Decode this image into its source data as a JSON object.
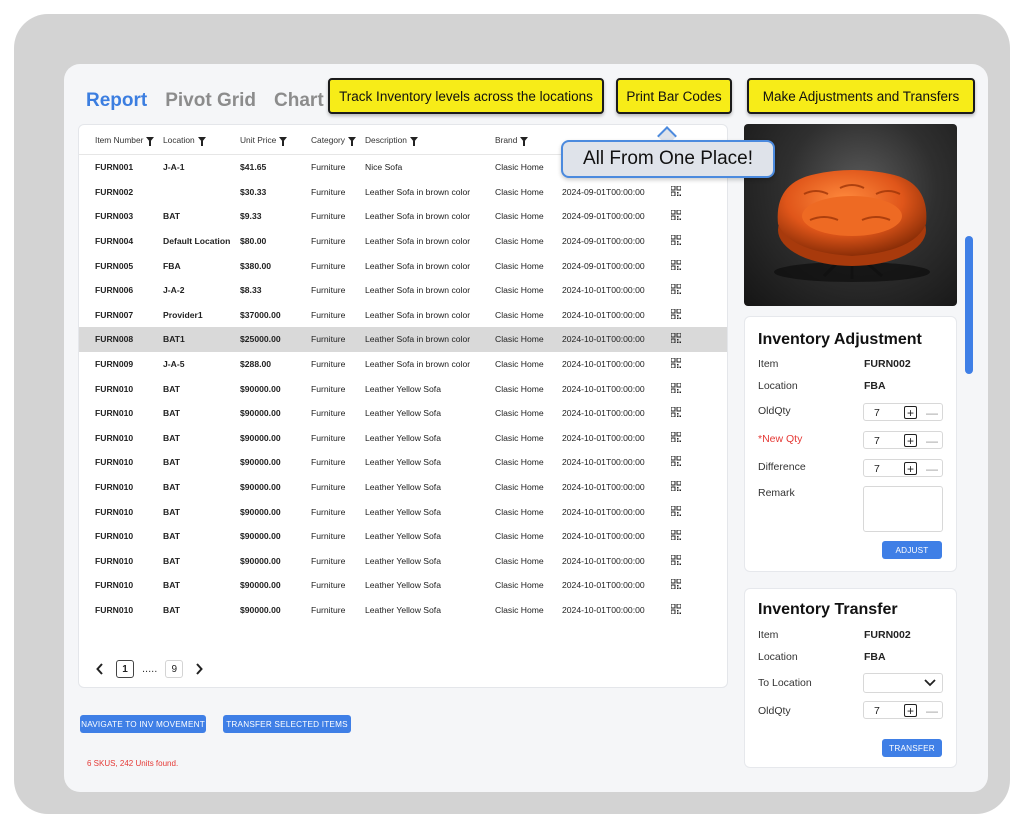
{
  "tabs": [
    {
      "label": "Report",
      "active": true
    },
    {
      "label": "Pivot Grid",
      "active": false
    },
    {
      "label": "Chart",
      "active": false
    }
  ],
  "callouts": {
    "track": "Track Inventory levels across the locations",
    "print": "Print Bar Codes",
    "adjust": "Make Adjustments and Transfers",
    "bubble": "All From One Place!"
  },
  "table": {
    "columns": [
      "Item Number",
      "Location",
      "Unit Price",
      "Category",
      "Description",
      "Brand"
    ],
    "rows": [
      {
        "item": "FURN001",
        "location": "J-A-1",
        "price": "$41.65",
        "category": "Furniture",
        "description": "Nice Sofa",
        "brand": "Clasic Home",
        "date": ""
      },
      {
        "item": "FURN002",
        "location": "",
        "price": "$30.33",
        "category": "Furniture",
        "description": "Leather Sofa in brown color",
        "brand": "Clasic Home",
        "date": "2024-09-01T00:00:00"
      },
      {
        "item": "FURN003",
        "location": "BAT",
        "price": "$9.33",
        "category": "Furniture",
        "description": "Leather Sofa in brown color",
        "brand": "Clasic Home",
        "date": "2024-09-01T00:00:00"
      },
      {
        "item": "FURN004",
        "location": "Default Location",
        "price": "$80.00",
        "category": "Furniture",
        "description": "Leather Sofa in brown color",
        "brand": "Clasic Home",
        "date": "2024-09-01T00:00:00"
      },
      {
        "item": "FURN005",
        "location": "FBA",
        "price": "$380.00",
        "category": "Furniture",
        "description": "Leather Sofa in brown color",
        "brand": "Clasic Home",
        "date": "2024-09-01T00:00:00"
      },
      {
        "item": "FURN006",
        "location": "J-A-2",
        "price": "$8.33",
        "category": "Furniture",
        "description": "Leather Sofa in brown color",
        "brand": "Clasic Home",
        "date": "2024-10-01T00:00:00"
      },
      {
        "item": "FURN007",
        "location": "Provider1",
        "price": "$37000.00",
        "category": "Furniture",
        "description": "Leather Sofa in brown color",
        "brand": "Clasic Home",
        "date": "2024-10-01T00:00:00"
      },
      {
        "item": "FURN008",
        "location": "BAT1",
        "price": "$25000.00",
        "category": "Furniture",
        "description": "Leather Sofa in brown color",
        "brand": "Clasic Home",
        "date": "2024-10-01T00:00:00",
        "selected": true
      },
      {
        "item": "FURN009",
        "location": "J-A-5",
        "price": "$288.00",
        "category": "Furniture",
        "description": "Leather Sofa in brown color",
        "brand": "Clasic Home",
        "date": "2024-10-01T00:00:00"
      },
      {
        "item": "FURN010",
        "location": "BAT",
        "price": "$90000.00",
        "category": "Furniture",
        "description": "Leather Yellow Sofa",
        "brand": "Clasic Home",
        "date": "2024-10-01T00:00:00"
      },
      {
        "item": "FURN010",
        "location": "BAT",
        "price": "$90000.00",
        "category": "Furniture",
        "description": "Leather Yellow Sofa",
        "brand": "Clasic Home",
        "date": "2024-10-01T00:00:00"
      },
      {
        "item": "FURN010",
        "location": "BAT",
        "price": "$90000.00",
        "category": "Furniture",
        "description": "Leather Yellow Sofa",
        "brand": "Clasic Home",
        "date": "2024-10-01T00:00:00"
      },
      {
        "item": "FURN010",
        "location": "BAT",
        "price": "$90000.00",
        "category": "Furniture",
        "description": "Leather Yellow Sofa",
        "brand": "Clasic Home",
        "date": "2024-10-01T00:00:00"
      },
      {
        "item": "FURN010",
        "location": "BAT",
        "price": "$90000.00",
        "category": "Furniture",
        "description": "Leather Yellow Sofa",
        "brand": "Clasic Home",
        "date": "2024-10-01T00:00:00"
      },
      {
        "item": "FURN010",
        "location": "BAT",
        "price": "$90000.00",
        "category": "Furniture",
        "description": "Leather Yellow Sofa",
        "brand": "Clasic Home",
        "date": "2024-10-01T00:00:00"
      },
      {
        "item": "FURN010",
        "location": "BAT",
        "price": "$90000.00",
        "category": "Furniture",
        "description": "Leather Yellow Sofa",
        "brand": "Clasic Home",
        "date": "2024-10-01T00:00:00"
      },
      {
        "item": "FURN010",
        "location": "BAT",
        "price": "$90000.00",
        "category": "Furniture",
        "description": "Leather Yellow Sofa",
        "brand": "Clasic Home",
        "date": "2024-10-01T00:00:00"
      },
      {
        "item": "FURN010",
        "location": "BAT",
        "price": "$90000.00",
        "category": "Furniture",
        "description": "Leather Yellow Sofa",
        "brand": "Clasic Home",
        "date": "2024-10-01T00:00:00"
      },
      {
        "item": "FURN010",
        "location": "BAT",
        "price": "$90000.00",
        "category": "Furniture",
        "description": "Leather Yellow Sofa",
        "brand": "Clasic Home",
        "date": "2024-10-01T00:00:00"
      }
    ]
  },
  "pager": {
    "current": "1",
    "ellipsis": ".....",
    "last": "9"
  },
  "buttons": {
    "navigate": "NAVIGATE TO INV MOVEMENT",
    "transfer_selected": "TRANSFER SELECTED ITEMS",
    "adjust": "ADJUST",
    "transfer": "TRANSFER"
  },
  "status": "6 SKUS, 242 Units found.",
  "adjustment": {
    "title": "Inventory Adjustment",
    "item_label": "Item",
    "item_value": "FURN002",
    "location_label": "Location",
    "location_value": "FBA",
    "oldqty_label": "OldQty",
    "oldqty_value": "7",
    "newqty_label": "*New Qty",
    "newqty_value": "7",
    "difference_label": "Difference",
    "difference_value": "7",
    "remark_label": "Remark"
  },
  "transfer": {
    "title": "Inventory Transfer",
    "item_label": "Item",
    "item_value": "FURN002",
    "location_label": "Location",
    "location_value": "FBA",
    "to_location_label": "To Location",
    "oldqty_label": "OldQty",
    "oldqty_value": "7"
  },
  "colors": {
    "accent": "#3f7fe6",
    "callout": "#f7ec18",
    "required": "#e53935"
  }
}
